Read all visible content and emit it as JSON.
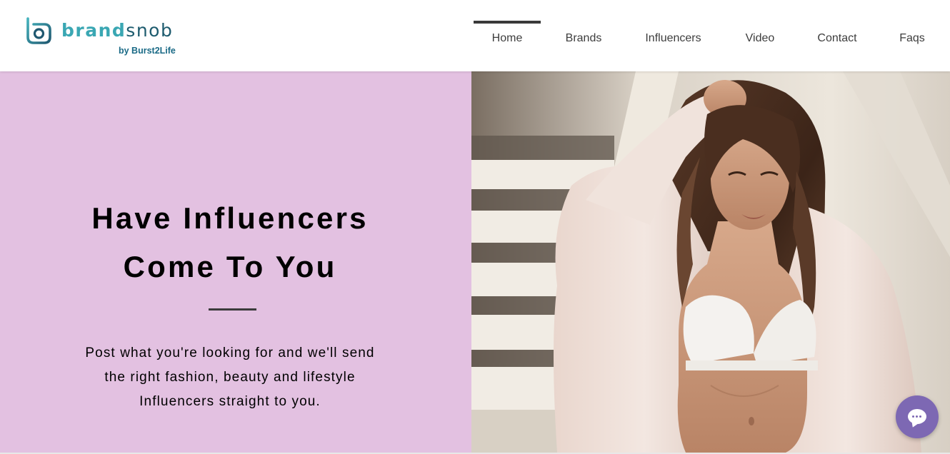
{
  "header": {
    "logo": {
      "word_part1": "brand",
      "word_part2": "snob",
      "byline": "by Burst2Life",
      "icon": "brandsnob-logo-icon"
    },
    "nav": [
      {
        "label": "Home",
        "active": true
      },
      {
        "label": "Brands",
        "active": false
      },
      {
        "label": "Influencers",
        "active": false
      },
      {
        "label": "Video",
        "active": false
      },
      {
        "label": "Contact",
        "active": false
      },
      {
        "label": "Faqs",
        "active": false
      }
    ]
  },
  "hero": {
    "title_line1": "Have Influencers",
    "title_line2": "Come To You",
    "text_line1": "Post what you're looking for and we'll send",
    "text_line2": "the right fashion, beauty and lifestyle",
    "text_line3": "Influencers straight to you.",
    "panel_color": "#e3c1e1"
  },
  "chat": {
    "icon": "chat-icon",
    "color": "#7d68b3"
  }
}
